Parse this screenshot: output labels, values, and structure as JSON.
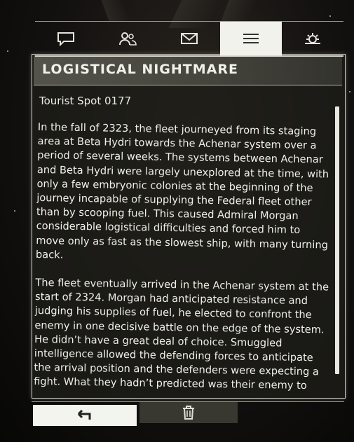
{
  "tabs": [
    {
      "icon": "chat-icon",
      "active": false
    },
    {
      "icon": "contacts-icon",
      "active": false
    },
    {
      "icon": "mail-icon",
      "active": false
    },
    {
      "icon": "list-icon",
      "active": true
    },
    {
      "icon": "settings-icon",
      "active": false
    }
  ],
  "title": "LOGISTICAL NIGHTMARE",
  "subject": "Tourist Spot 0177",
  "paragraphs": [
    "In the fall of 2323, the fleet journeyed from its staging area at Beta Hydri towards the Achenar system over a period of several weeks. The systems between Achenar and Beta Hydri were largely unexplored at the time, with only a few embryonic colonies at the beginning of the journey incapable of supplying the Federal fleet other than by scooping fuel. This caused Admiral Morgan considerable logistical difficulties and forced him to move only as fast as the slowest ship, with many turning back.",
    "The fleet eventually arrived in the Achenar system at the start of 2324. Morgan had anticipated resistance and judging his supplies of fuel, he elected to confront the enemy in one decisive battle on the edge of the system. He didn’t have a great deal of choice. Smuggled intelligence allowed the defending forces to anticipate the arrival position and the defenders were expecting a fight. What they hadn’t predicted was their enemy to use their"
  ],
  "buttons": {
    "back_icon": "back-arrow-icon",
    "delete_icon": "trash-icon"
  },
  "colors": {
    "panel_text": "#f0f0e8",
    "active_tab": "#f2f2ec"
  }
}
